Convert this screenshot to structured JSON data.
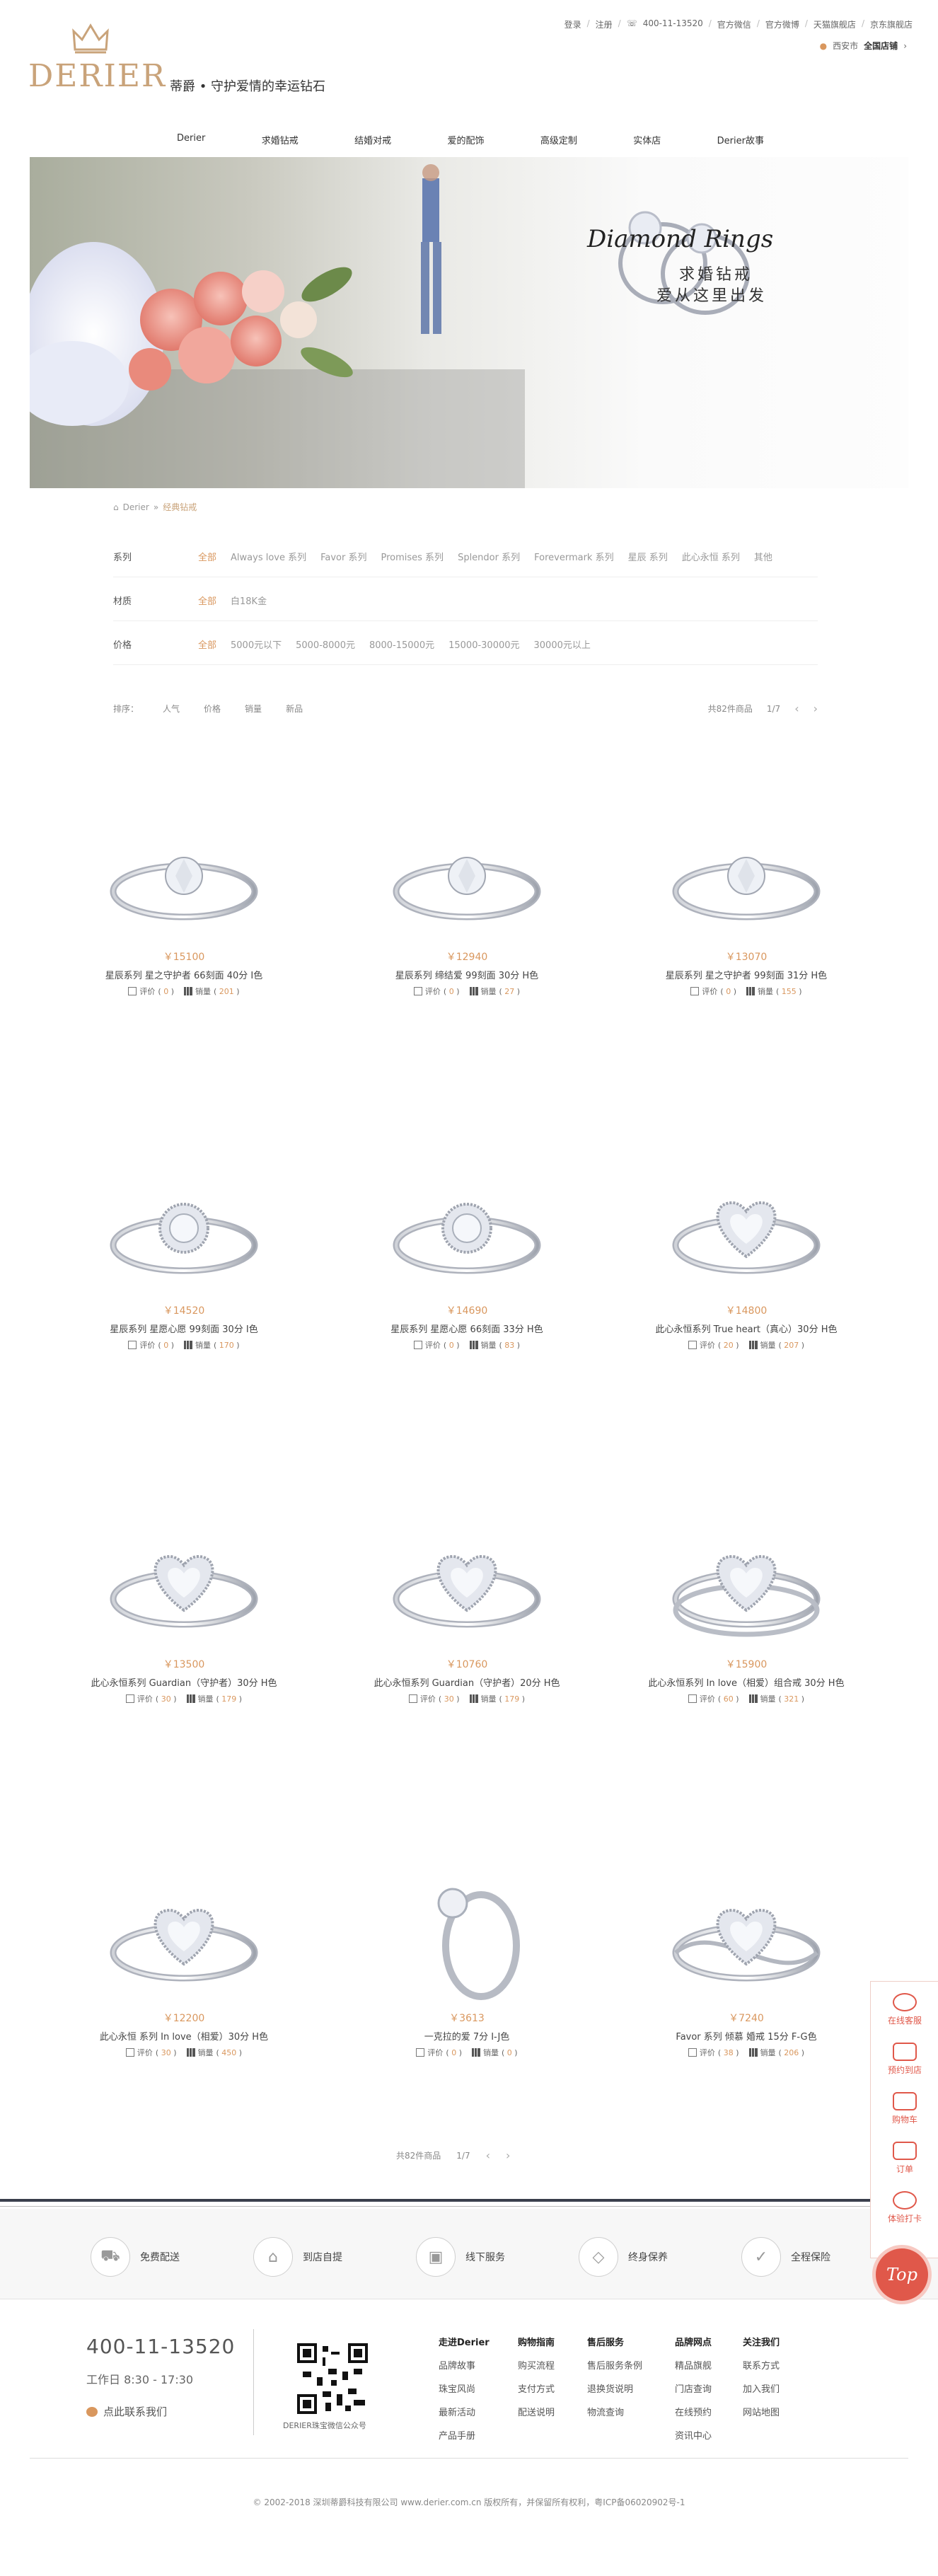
{
  "header": {
    "links": [
      "登录",
      "注册",
      "400-11-13520",
      "官方微信",
      "官方微博",
      "天猫旗舰店",
      "京东旗舰店"
    ],
    "city": "西安市",
    "store": "全国店铺",
    "brand": "DERIER",
    "slogan": "蒂爵 • 守护爱情的幸运钻石"
  },
  "nav": [
    "Derier",
    "求婚钻戒",
    "结婚对戒",
    "爱的配饰",
    "高级定制",
    "实体店",
    "Derier故事"
  ],
  "banner": {
    "script_text": "Diamond Rings",
    "line1": "求婚钻戒",
    "line2": "爱从这里出发"
  },
  "breadcrumb": {
    "home": "Derier",
    "sep": "»",
    "current": "经典钻戒"
  },
  "filters": [
    {
      "label": "系列",
      "options": [
        "全部",
        "Always love 系列",
        "Favor 系列",
        "Promises 系列",
        "Splendor 系列",
        "Forevermark 系列",
        "星辰 系列",
        "此心永恒 系列",
        "其他"
      ]
    },
    {
      "label": "材质",
      "options": [
        "全部",
        "白18K金"
      ]
    },
    {
      "label": "价格",
      "options": [
        "全部",
        "5000元以下",
        "5000-8000元",
        "8000-15000元",
        "15000-30000元",
        "30000元以上"
      ]
    }
  ],
  "sort": {
    "label": "排序：",
    "options": [
      "人气",
      "价格",
      "销量",
      "新品"
    ],
    "count": "共82件商品",
    "page": "1/7"
  },
  "products": [
    {
      "price": "￥15100",
      "name": "星辰系列 星之守护者 66刻面 40分 I色",
      "reviews": "0",
      "sales": "201"
    },
    {
      "price": "￥12940",
      "name": "星辰系列 缔结爱 99刻面 30分 H色",
      "reviews": "0",
      "sales": "27"
    },
    {
      "price": "￥13070",
      "name": "星辰系列 星之守护者 99刻面 31分 H色",
      "reviews": "0",
      "sales": "155"
    },
    {
      "price": "￥14520",
      "name": "星辰系列 星愿心愿 99刻面 30分 I色",
      "reviews": "0",
      "sales": "170"
    },
    {
      "price": "￥14690",
      "name": "星辰系列 星愿心愿 66刻面 33分 H色",
      "reviews": "0",
      "sales": "83"
    },
    {
      "price": "￥14800",
      "name": "此心永恒系列 True heart（真心）30分 H色",
      "reviews": "20",
      "sales": "207"
    },
    {
      "price": "￥13500",
      "name": "此心永恒系列 Guardian（守护者）30分 H色",
      "reviews": "30",
      "sales": "179"
    },
    {
      "price": "￥10760",
      "name": "此心永恒系列 Guardian（守护者）20分 H色",
      "reviews": "30",
      "sales": "179"
    },
    {
      "price": "￥15900",
      "name": "此心永恒系列 In love（相爱）组合戒 30分 H色",
      "reviews": "60",
      "sales": "321"
    },
    {
      "price": "￥12200",
      "name": "此心永恒 系列 In love（相爱）30分 H色",
      "reviews": "30",
      "sales": "450"
    },
    {
      "price": "￥3613",
      "name": "一克拉的爱 7分 I-J色",
      "reviews": "0",
      "sales": "0"
    },
    {
      "price": "￥7240",
      "name": "Favor 系列 倾慕 婚戒 15分 F-G色",
      "reviews": "38",
      "sales": "206"
    }
  ],
  "labels": {
    "reviews": "评价",
    "sales": "销量"
  },
  "pager": {
    "count": "共82件商品",
    "page": "1/7"
  },
  "services": [
    "免费配送",
    "到店自提",
    "线下服务",
    "终身保养",
    "全程保险"
  ],
  "footer": {
    "hotline": "400-11-13520",
    "hours": "工作日 8:30 - 17:30",
    "contact": "点此联系我们",
    "qr_caption": "DERIER珠宝微信公众号",
    "columns": [
      {
        "title": "走进Derier",
        "items": [
          "品牌故事",
          "珠宝风尚",
          "最新活动",
          "产品手册"
        ]
      },
      {
        "title": "购物指南",
        "items": [
          "购买流程",
          "支付方式",
          "配送说明"
        ]
      },
      {
        "title": "售后服务",
        "items": [
          "售后服务条例",
          "退换货说明",
          "物流查询"
        ]
      },
      {
        "title": "品牌网点",
        "items": [
          "精品旗舰",
          "门店查询",
          "在线预约",
          "资讯中心"
        ]
      },
      {
        "title": "关注我们",
        "items": [
          "联系方式",
          "加入我们",
          "网站地图"
        ]
      }
    ],
    "copyright": "© 2002-2018 深圳蒂爵科技有限公司 www.derier.com.cn 版权所有，并保留所有权利，粤ICP备06020902号-1"
  },
  "side_tools": [
    "在线客服",
    "预约到店",
    "购物车",
    "订单",
    "体验打卡"
  ],
  "top_button": "Top",
  "colors": {
    "accent": "#d9975e",
    "red": "#e0584a",
    "gold": "#c9a37a"
  }
}
